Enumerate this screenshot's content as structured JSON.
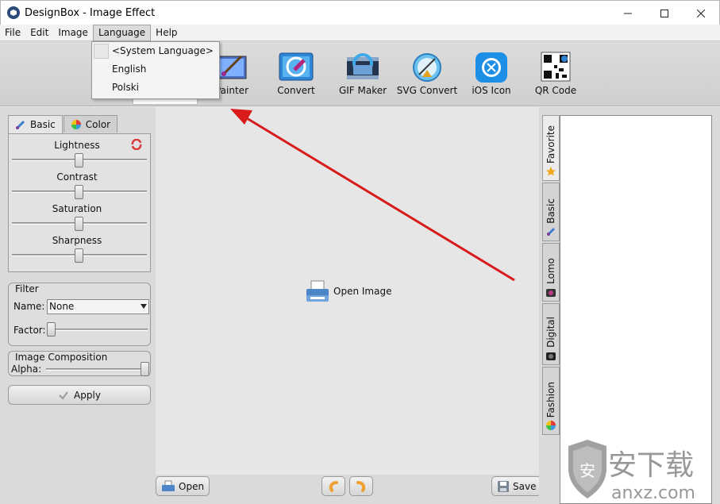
{
  "window": {
    "title": "DesignBox - Image Effect"
  },
  "menu": {
    "file": "File",
    "edit": "Edit",
    "image": "Image",
    "language": "Language",
    "help": "Help"
  },
  "language_menu": {
    "items": [
      "<System Language>",
      "English",
      "Polski"
    ]
  },
  "toolbar": {
    "painter": "Painter",
    "convert": "Convert",
    "gif_maker": "GIF Maker",
    "svg_convert": "SVG Convert",
    "ios_icon": "iOS Icon",
    "qr_code": "QR Code"
  },
  "left": {
    "tabs": {
      "basic": "Basic",
      "color": "Color"
    },
    "adjust": {
      "lightness": "Lightness",
      "contrast": "Contrast",
      "saturation": "Saturation",
      "sharpness": "Sharpness"
    },
    "filter": {
      "title": "Filter",
      "name_label": "Name:",
      "name_value": "None",
      "factor_label": "Factor:"
    },
    "composition": {
      "title": "Image Composition",
      "alpha_label": "Alpha:"
    },
    "apply": "Apply"
  },
  "center": {
    "open_image": "Open Image"
  },
  "bottom": {
    "open": "Open",
    "save": "Save"
  },
  "side_tabs": [
    "Favorite",
    "Basic",
    "Lomo",
    "Digital",
    "Fashion"
  ],
  "watermark": {
    "text": "安下载",
    "domain": "anxz.com"
  },
  "annotation": {
    "arrow_color": "#d81b1b"
  }
}
